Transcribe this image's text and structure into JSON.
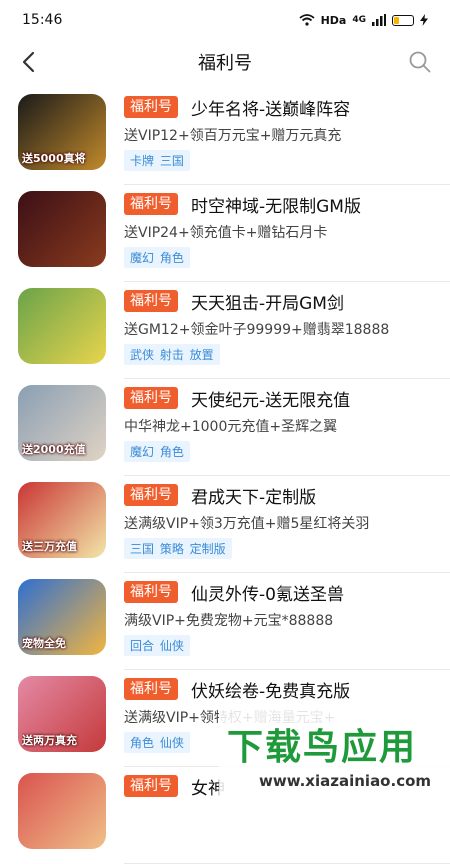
{
  "status": {
    "time": "15:46",
    "network": "HDa",
    "signal": "4G"
  },
  "nav": {
    "title": "福利号"
  },
  "items": [
    {
      "tag": "福利号",
      "title": "少年名将-送巅峰阵容",
      "desc": "送VIP12+领百万元宝+赠万元真充",
      "chips": "卡牌 三国",
      "thumb_text": "送5000真将",
      "colors": [
        "#1a1a1a",
        "#c28a2b"
      ]
    },
    {
      "tag": "福利号",
      "title": "时空神域-无限制GM版",
      "desc": "送VIP24+领充值卡+赠钻石月卡",
      "chips": "魔幻 角色",
      "thumb_text": "",
      "colors": [
        "#3b0f16",
        "#8a3b1e"
      ]
    },
    {
      "tag": "福利号",
      "title": "天天狙击-开局GM剑",
      "desc": "送GM12+领金叶子99999+赠翡翠18888",
      "chips": "武侠 射击 放置",
      "thumb_text": "",
      "colors": [
        "#6aa34a",
        "#e8d44d"
      ]
    },
    {
      "tag": "福利号",
      "title": "天使纪元-送无限充值",
      "desc": "中华神龙+1000元充值+圣辉之翼",
      "chips": "魔幻 角色",
      "thumb_text": "送2000充值",
      "colors": [
        "#8a9fb3",
        "#e0d3c4"
      ]
    },
    {
      "tag": "福利号",
      "title": "君成天下-定制版",
      "desc": "送满级VIP+领3万充值+赠5星红将关羽",
      "chips": "三国 策略 定制版",
      "thumb_text": "送三万充值",
      "colors": [
        "#c93636",
        "#f2e6a8"
      ]
    },
    {
      "tag": "福利号",
      "title": "仙灵外传-0氪送圣兽",
      "desc": "满级VIP+免费宠物+元宝*88888",
      "chips": "回合 仙侠",
      "thumb_text": "宠物全免",
      "colors": [
        "#2f6fd1",
        "#f2b540"
      ]
    },
    {
      "tag": "福利号",
      "title": "伏妖绘卷-免费真充版",
      "desc": "送满级VIP+领特权+赠海量元宝+",
      "chips": "角色 仙侠",
      "thumb_text": "送两万真充",
      "colors": [
        "#e48aa6",
        "#c43a3a"
      ]
    },
    {
      "tag": "福利号",
      "title": "女神",
      "desc": "",
      "chips": "",
      "thumb_text": "",
      "colors": [
        "#d9534f",
        "#f0c08a"
      ]
    }
  ],
  "watermark": {
    "brand": "下载鸟应用",
    "url": "www.xiazainiao.com"
  },
  "battery_level": 0.3
}
